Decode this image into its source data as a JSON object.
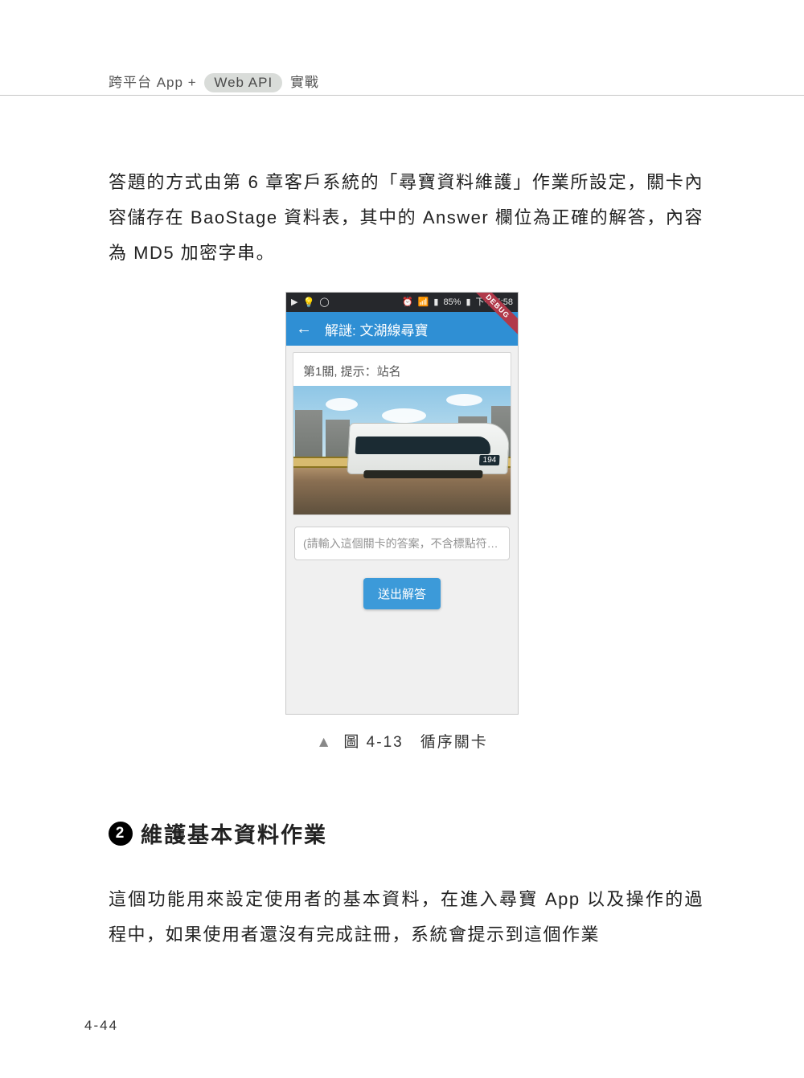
{
  "header": {
    "prefix": "跨平台 App +",
    "badge": "Web API",
    "suffix": "實戰"
  },
  "paragraph1": "答題的方式由第 6 章客戶系統的「尋寶資料維護」作業所設定，關卡內容儲存在 BaoStage 資料表，其中的 Answer 欄位為正確的解答，內容為 MD5 加密字串。",
  "figure": {
    "caption_prefix": "▲",
    "caption": "圖 4-13　循序關卡"
  },
  "phone": {
    "statusbar": {
      "left_icons": [
        "youtube-icon",
        "bulb-icon",
        "circle-icon"
      ],
      "alarm": "⏰",
      "wifi": "📶",
      "signal": "▮",
      "battery_text": "85%",
      "time": "下午 5:58"
    },
    "debug_label": "DEBUG",
    "appbar": {
      "back": "←",
      "title": "解謎: 文湖線尋寶"
    },
    "card": {
      "title": "第1關, 提示：站名",
      "train_number": "194"
    },
    "answer_placeholder": "(請輸入這個關卡的答案，不含標點符…",
    "submit_label": "送出解答"
  },
  "section2": {
    "number": "2",
    "title": "維護基本資料作業"
  },
  "paragraph2": "這個功能用來設定使用者的基本資料，在進入尋寶 App 以及操作的過程中，如果使用者還沒有完成註冊，系統會提示到這個作業",
  "page_number": "4-44"
}
